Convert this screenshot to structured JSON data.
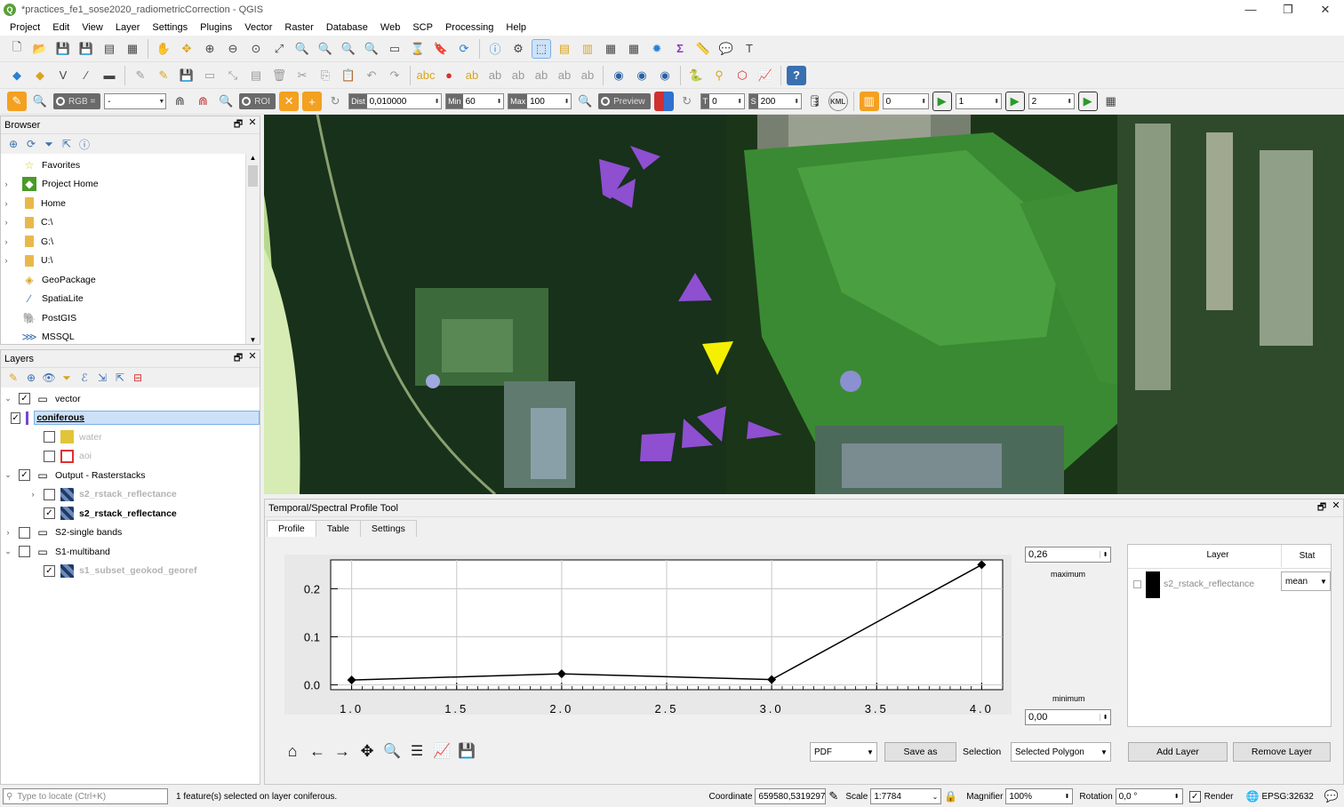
{
  "window": {
    "title": "*practices_fe1_sose2020_radiometricCorrection - QGIS",
    "minimize": "—",
    "maximize": "❐",
    "close": "✕"
  },
  "menu": [
    "Project",
    "Edit",
    "View",
    "Layer",
    "Settings",
    "Plugins",
    "Vector",
    "Raster",
    "Database",
    "Web",
    "SCP",
    "Processing",
    "Help"
  ],
  "scp_toolbar": {
    "rgb_label": "RGB =",
    "rgb_value": "-",
    "roi_label": "ROI",
    "dist_label": "Dist",
    "dist_value": "0,010000",
    "min_label": "Min",
    "min_value": "60",
    "max_label": "Max",
    "max_value": "100",
    "preview_label": "Preview",
    "t_label": "T",
    "t_value": "0",
    "s_label": "S",
    "s_value": "200",
    "kml_label": "KML",
    "band1": "0",
    "band2": "1",
    "band3": "2"
  },
  "browser": {
    "title": "Browser",
    "items": [
      "Favorites",
      "Project Home",
      "Home",
      "C:\\",
      "G:\\",
      "U:\\",
      "GeoPackage",
      "SpatiaLite",
      "PostGIS",
      "MSSQL"
    ]
  },
  "layers": {
    "title": "Layers",
    "groups": {
      "vector": "vector",
      "coniferous": "coniferous",
      "water": "water",
      "aoi": "aoi",
      "output": "Output - Rasterstacks",
      "stack1": "s2_rstack_reflectance",
      "stack2": "s2_rstack_reflectance",
      "single": "S2-single bands",
      "s1": "S1-multiband",
      "s1sub": "s1_subset_geokod_georef"
    },
    "colors": {
      "coniferous": "#7b45c8",
      "water": "#e2c43a",
      "aoi": "#e03030"
    }
  },
  "profile_tool": {
    "title": "Temporal/Spectral Profile Tool",
    "tabs": [
      "Profile",
      "Table",
      "Settings"
    ],
    "maximum_value": "0,26",
    "maximum_label": "maximum",
    "minimum_label": "minimum",
    "minimum_value": "0,00",
    "table_header_layer": "Layer",
    "table_header_stat": "Stat",
    "table_layer": "s2_rstack_reflectance",
    "table_stat": "mean",
    "format": "PDF",
    "save_as": "Save as",
    "selection_label": "Selection",
    "selection_value": "Selected Polygon",
    "add_layer": "Add Layer",
    "remove_layer": "Remove Layer"
  },
  "chart_data": {
    "type": "line",
    "x": [
      1.0,
      2.0,
      3.0,
      4.0
    ],
    "series": [
      {
        "values": [
          0.01,
          0.023,
          0.011,
          0.25
        ]
      }
    ],
    "xlim": [
      0.9,
      4.1
    ],
    "ylim": [
      -0.01,
      0.26
    ],
    "xticks": [
      "1.0",
      "1.5",
      "2.0",
      "2.5",
      "3.0",
      "3.5",
      "4.0"
    ],
    "yticks": [
      "0.0",
      "0.1",
      "0.2"
    ],
    "grid": true,
    "title": "",
    "xlabel": "",
    "ylabel": ""
  },
  "statusbar": {
    "locate_placeholder": "Type to locate (Ctrl+K)",
    "message": "1 feature(s) selected on layer coniferous.",
    "coordinate_label": "Coordinate",
    "coordinate_value": "659580,5319297",
    "scale_label": "Scale",
    "scale_value": "1:7784",
    "magnifier_label": "Magnifier",
    "magnifier_value": "100%",
    "rotation_label": "Rotation",
    "rotation_value": "0,0 °",
    "render_label": "Render",
    "crs": "EPSG:32632"
  }
}
